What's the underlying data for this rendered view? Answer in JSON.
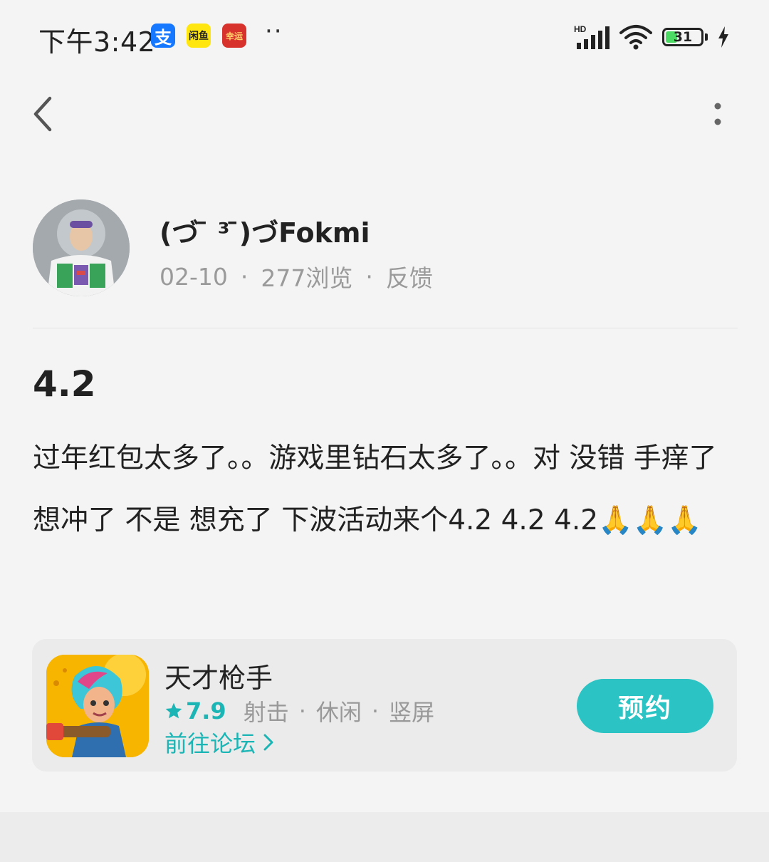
{
  "status_bar": {
    "time": "下午3:42",
    "apps": [
      {
        "name": "alipay-icon",
        "glyph": "支"
      },
      {
        "name": "xianyu-icon",
        "glyph": "闲鱼"
      },
      {
        "name": "red-app-icon",
        "glyph": "幸运"
      }
    ],
    "more": "··",
    "network_label": "HD",
    "battery_level": "31",
    "battery_fraction": 0.31
  },
  "nav": {
    "back_icon": "chevron-left-icon",
    "more_icon": "more-vertical-icon"
  },
  "author": {
    "name": "(づ ̄ ³ ̄)づFokmi",
    "date": "02-10",
    "views": "277浏览",
    "feedback": "反馈",
    "sep": "·"
  },
  "post": {
    "title": "4.2",
    "body": "过年红包太多了。。游戏里钻石太多了。。对 没错 手痒了 想冲了 不是 想充了 下波活动来个4.2 4.2 4.2🙏🙏🙏"
  },
  "game_card": {
    "name": "天才枪手",
    "rating": "7.9",
    "tags": [
      "射击",
      "休闲",
      "竖屏"
    ],
    "sep": "·",
    "forum_link": "前往论坛",
    "reserve_label": "预约",
    "accent_color": "#2bc3c3"
  }
}
